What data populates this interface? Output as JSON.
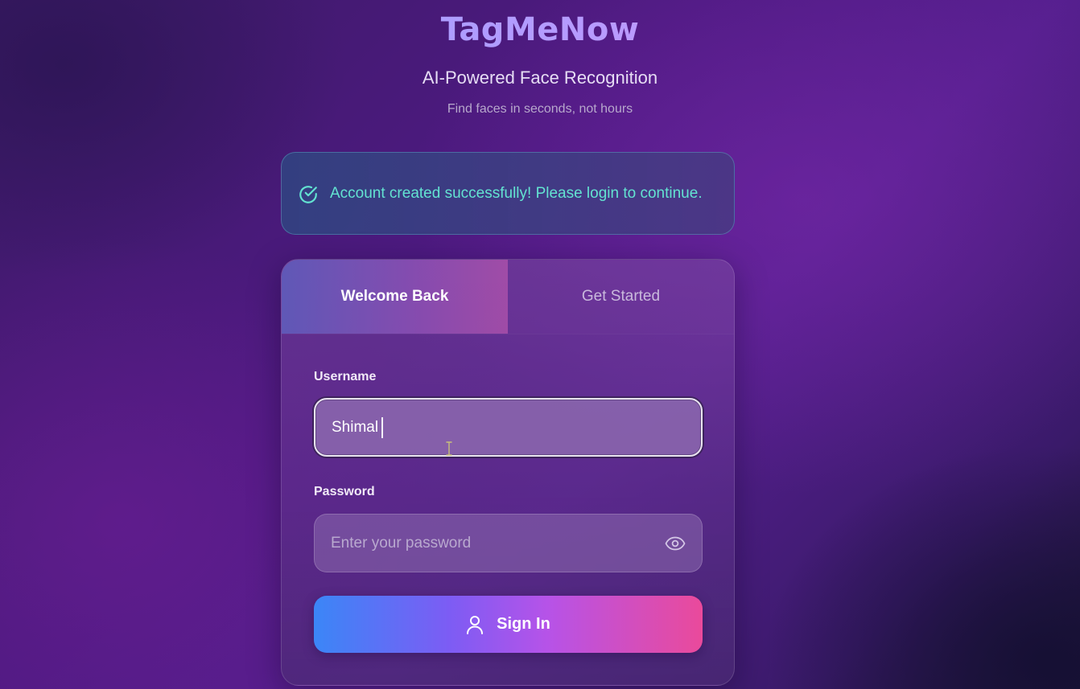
{
  "header": {
    "brand": "TagMeNow",
    "subtitle": "AI-Powered Face Recognition",
    "tagline": "Find faces in seconds, not hours"
  },
  "alert": {
    "icon": "check-circle-icon",
    "message": "Account created successfully! Please login to continue.",
    "color": "#63e3d1"
  },
  "auth_card": {
    "tabs": [
      {
        "label": "Welcome Back",
        "active": true
      },
      {
        "label": "Get Started",
        "active": false
      }
    ],
    "username": {
      "label": "Username",
      "value": "Shimal"
    },
    "password": {
      "label": "Password",
      "placeholder": "Enter your password",
      "toggle_icon": "eye-icon"
    },
    "submit": {
      "label": "Sign In",
      "icon": "user-icon"
    }
  },
  "colors": {
    "brand_gradient": [
      "#8fa2ff",
      "#d78cf2"
    ],
    "button_gradient": [
      "#3b86f7",
      "#b653e8",
      "#ea4a9b"
    ],
    "success": "#63e3d1"
  }
}
